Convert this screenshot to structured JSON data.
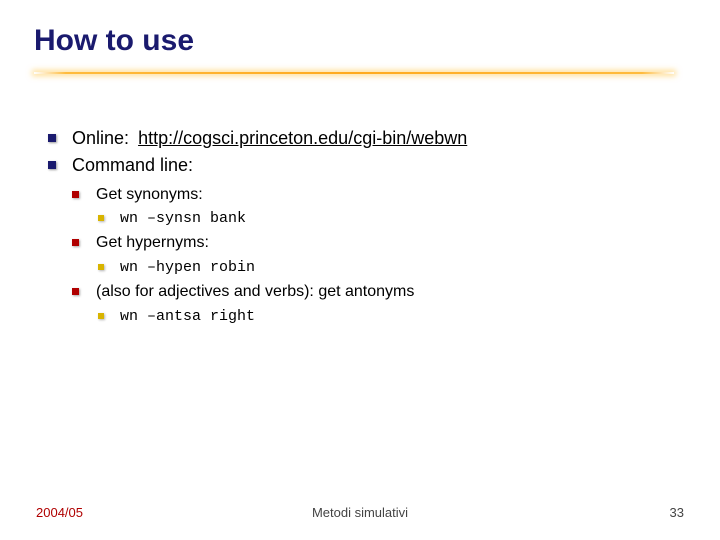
{
  "title": "How to use",
  "bullets": {
    "online_label": "Online:",
    "online_url": "http://cogsci.princeton.edu/cgi-bin/webwn",
    "cmdline_label": "Command line:",
    "syn_label": "Get synonyms:",
    "syn_cmd": "wn –synsn bank",
    "hyp_label": "Get hypernyms:",
    "hyp_cmd": "wn –hypen robin",
    "ant_label": "(also for adjectives and verbs): get antonyms",
    "ant_cmd": "wn –antsa right"
  },
  "footer": {
    "left": "2004/05",
    "center": "Metodi simulativi",
    "right": "33"
  }
}
